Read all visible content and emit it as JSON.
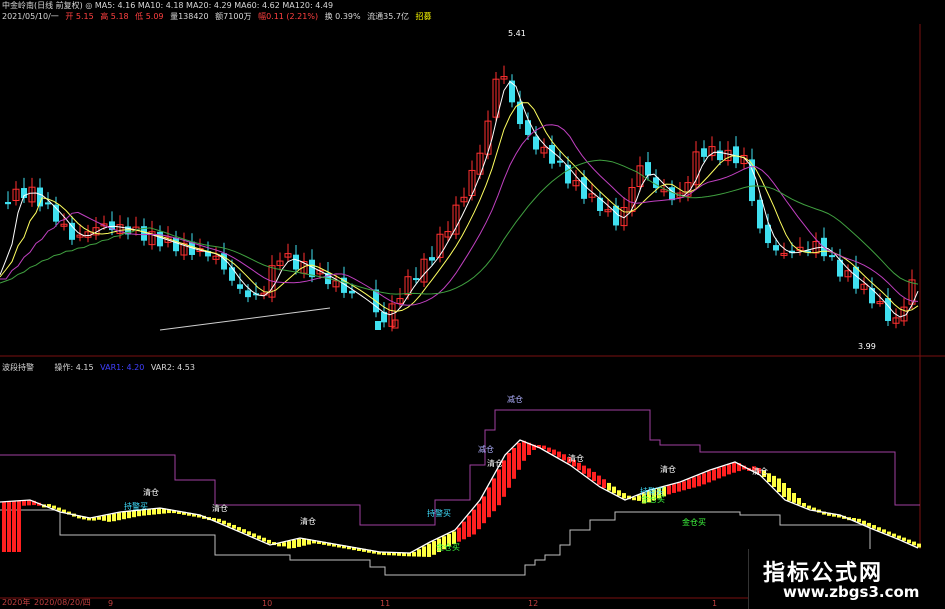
{
  "top_header": {
    "row1": "中金岭南(日线 前复权) ◎ MA5: 4.16 MA10: 4.18 MA20: 4.29 MA60: 4.62 MA120: 4.49",
    "row2_date": "2021/05/10/一",
    "row2_open": "开 5.15",
    "row2_high": "高 5.18",
    "row2_low": "低 5.09",
    "row2_vol": "量138420",
    "row2_amount": "额7100万",
    "row2_pct": "幅0.11 (2.21%)",
    "row2_turn": "换 0.39%",
    "row2_float": "流通35.7亿",
    "row2_extra": "招募"
  },
  "main_price_labels": {
    "high": "5.41",
    "low": "3.99"
  },
  "indicator_header": {
    "name": "波段持警",
    "op": "操作: 4.15",
    "var1": "VAR1: 4.20",
    "var2": "VAR2: 4.53"
  },
  "signals": [
    {
      "text": "减仓",
      "color": "#b0b0ff"
    },
    {
      "text": "减仓",
      "color": "#b0b0ff"
    },
    {
      "text": "清仓",
      "color": "#ffffff"
    },
    {
      "text": "清仓",
      "color": "#ffffff"
    },
    {
      "text": "清仓",
      "color": "#ffffff"
    },
    {
      "text": "清仓",
      "color": "#ffffff"
    },
    {
      "text": "清仓",
      "color": "#ffffff"
    },
    {
      "text": "清仓",
      "color": "#ffffff"
    },
    {
      "text": "清仓",
      "color": "#ffffff"
    },
    {
      "text": "持警买",
      "color": "#40e0ff"
    },
    {
      "text": "持警买",
      "color": "#40e0ff"
    },
    {
      "text": "持警买",
      "color": "#40e0ff"
    },
    {
      "text": "金仓买",
      "color": "#40ff40"
    },
    {
      "text": "金仓买",
      "color": "#40ff40"
    },
    {
      "text": "金仓买",
      "color": "#40ff40"
    }
  ],
  "dates": [
    "2020年",
    "2020/08/20/四",
    "9",
    "10",
    "11",
    "12",
    "1"
  ],
  "watermark": {
    "line1": "指标公式网",
    "line2": "www.zbgs3.com"
  }
}
